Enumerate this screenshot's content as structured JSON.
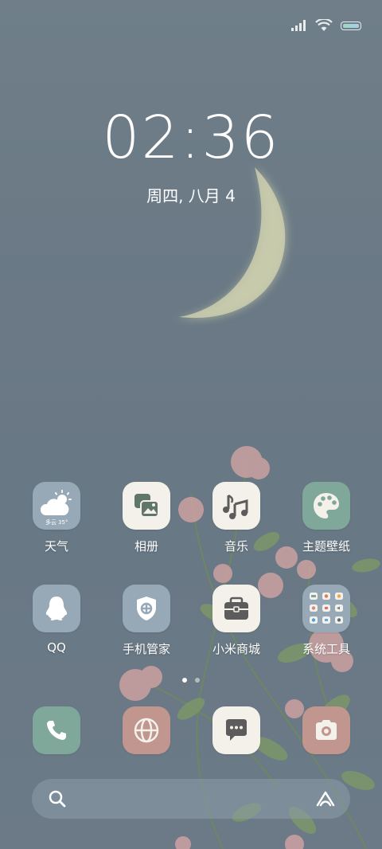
{
  "status_bar": {
    "signal_icon": "signal-icon",
    "wifi_icon": "wifi-icon",
    "battery_icon": "battery-icon"
  },
  "clock": {
    "time": "02:36",
    "date": "周四, 八月 4"
  },
  "apps": [
    {
      "label": "天气",
      "icon": "weather-icon",
      "bg": "#97a8b6",
      "weather": {
        "text": "多云",
        "temp": "35°"
      }
    },
    {
      "label": "相册",
      "icon": "gallery-icon",
      "bg": "#f4f1ea"
    },
    {
      "label": "音乐",
      "icon": "music-icon",
      "bg": "#f4f1ea"
    },
    {
      "label": "主题壁纸",
      "icon": "palette-icon",
      "bg": "#7fa89a"
    },
    {
      "label": "QQ",
      "icon": "qq-icon",
      "bg": "#97a8b6"
    },
    {
      "label": "手机管家",
      "icon": "security-icon",
      "bg": "#97a8b6"
    },
    {
      "label": "小米商城",
      "icon": "store-icon",
      "bg": "#f4f1ea"
    },
    {
      "label": "系统工具",
      "icon": "folder-icon",
      "bg": "#97a8b6"
    }
  ],
  "page_indicator": {
    "pages": 2,
    "active": 1
  },
  "dock": [
    {
      "name": "phone",
      "icon": "phone-icon",
      "bg": "#7fa89a"
    },
    {
      "name": "browser",
      "icon": "globe-icon",
      "bg": "#c0968f"
    },
    {
      "name": "messages",
      "icon": "message-icon",
      "bg": "#f4f1ea"
    },
    {
      "name": "camera",
      "icon": "camera-icon",
      "bg": "#c0968f"
    }
  ],
  "search_bar": {
    "search_icon": "search-icon",
    "assistant_icon": "assistant-icon"
  }
}
